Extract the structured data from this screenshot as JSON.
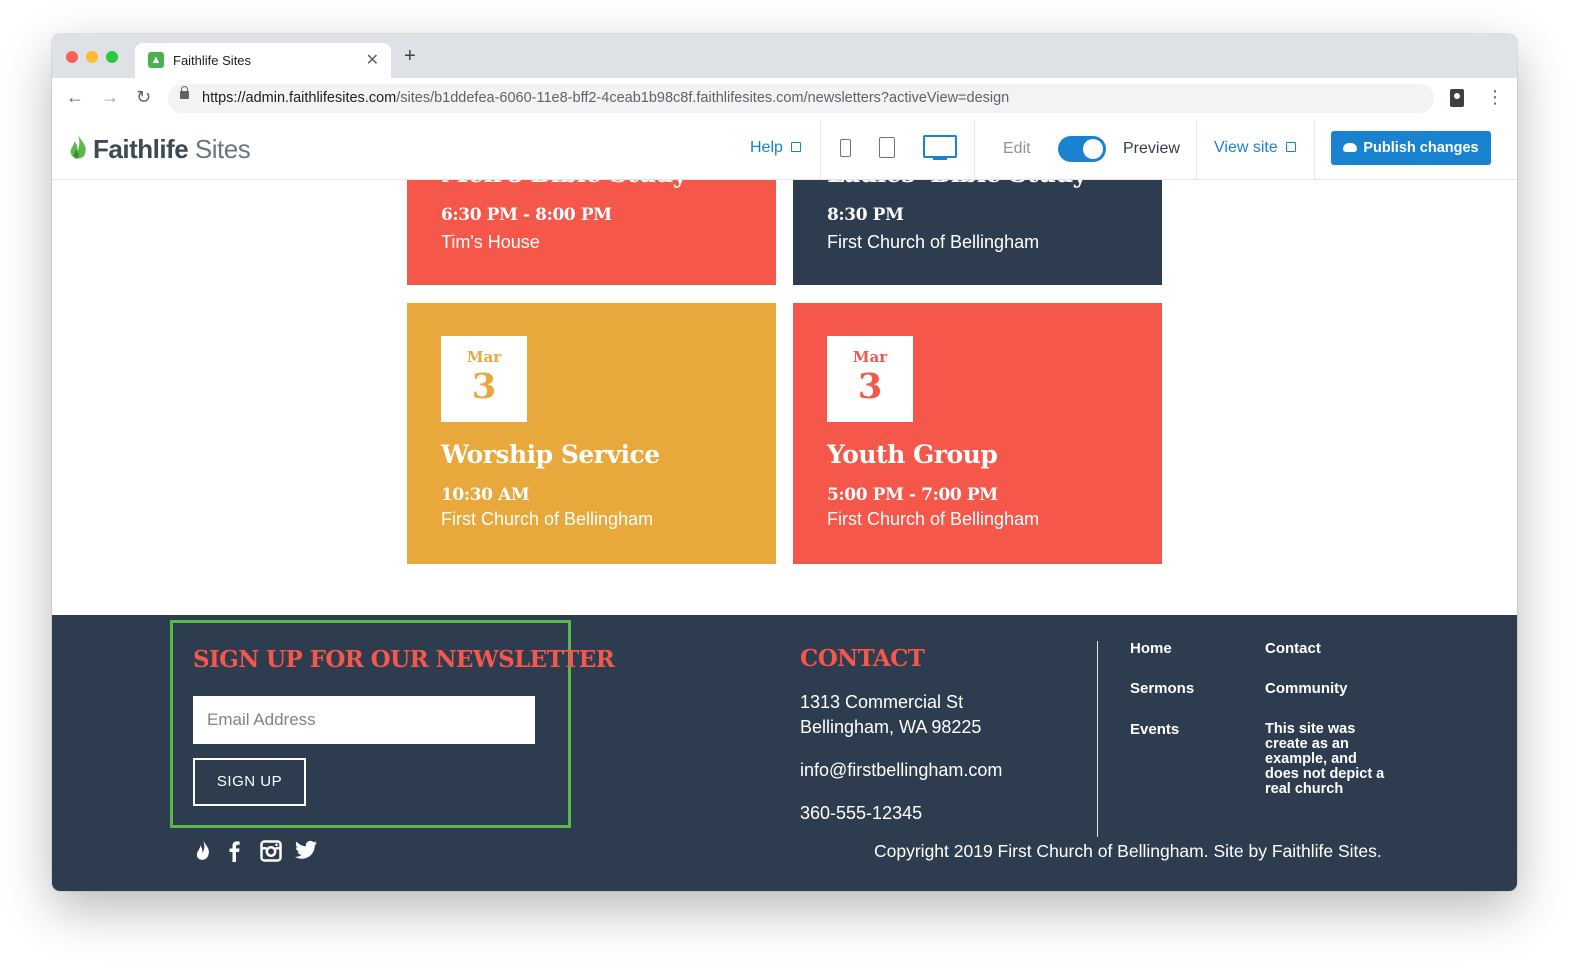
{
  "browser": {
    "tab_title": "Faithlife Sites",
    "url_host": "https://admin.faithlifesites.com",
    "url_path": "/sites/b1ddefea-6060-11e8-bff2-4ceab1b98c8f.faithlifesites.com/newsletters?activeView=design"
  },
  "header": {
    "logo_bold": "Faithlife",
    "logo_light": " Sites",
    "help_label": "Help",
    "edit_label": "Edit",
    "preview_label": "Preview",
    "view_site_label": "View site",
    "publish_label": "Publish changes"
  },
  "events": [
    {
      "title": "Men's Bible Study",
      "time": "6:30 PM - 8:00 PM",
      "location": "Tim's House"
    },
    {
      "title": "Ladies' Bible Study",
      "time": "8:30 PM",
      "location": "First Church of Bellingham"
    },
    {
      "month": "Mar",
      "day": "3",
      "title": "Worship Service",
      "time": "10:30 AM",
      "location": "First Church of Bellingham"
    },
    {
      "month": "Mar",
      "day": "3",
      "title": "Youth Group",
      "time": "5:00 PM - 7:00 PM",
      "location": "First Church of Bellingham"
    }
  ],
  "footer": {
    "newsletter_title": "SIGN UP FOR OUR NEWSLETTER",
    "email_placeholder": "Email Address",
    "signup_label": "SIGN UP",
    "contact_title": "CONTACT",
    "address_line1": "1313 Commercial St",
    "address_line2": "Bellingham, WA 98225",
    "email": "info@firstbellingham.com",
    "phone": "360-555-12345",
    "links": [
      "Home",
      "Contact",
      "Sermons",
      "Community",
      "Events"
    ],
    "note": "This site was create as an example, and does not depict a real church",
    "copyright": "Copyright 2019 First Church of Bellingham. Site by Faithlife Sites."
  },
  "colors": {
    "accent_blue": "#1982d1",
    "card_red": "#f5574a",
    "card_navy": "#2e3c50",
    "card_gold": "#e8a83b",
    "highlight_green": "#59b848"
  }
}
